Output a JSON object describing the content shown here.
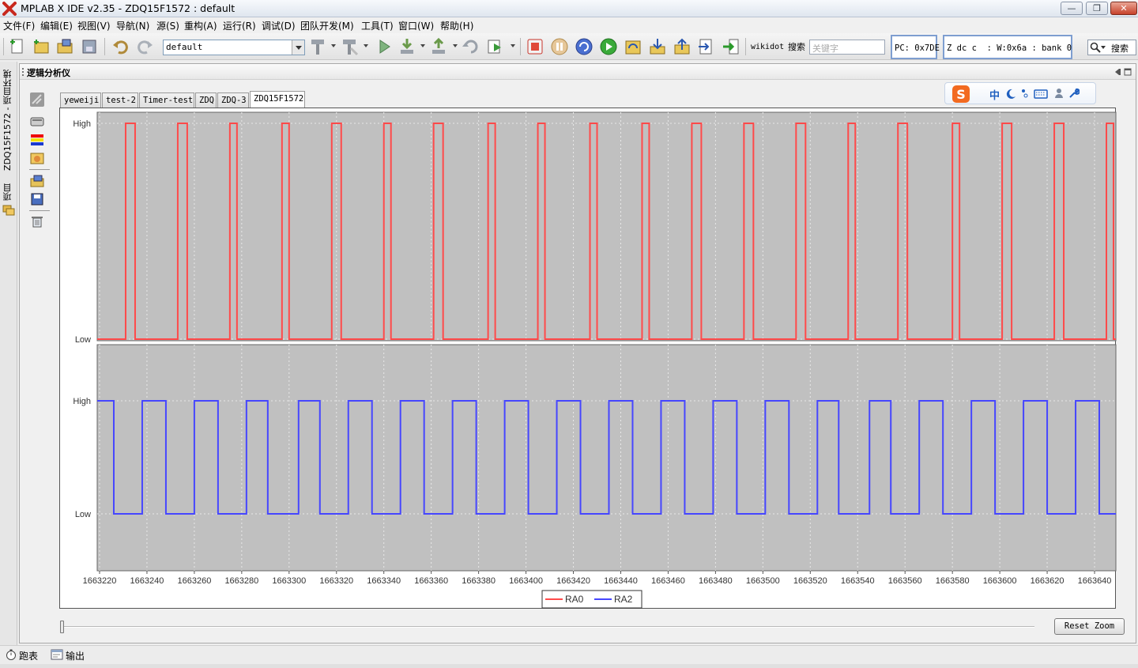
{
  "window": {
    "title": "MPLAB X IDE v2.35 - ZDQ15F1572 : default",
    "controls": {
      "minimize": "—",
      "maximize": "❐",
      "close": "✕"
    }
  },
  "menu": [
    "文件(F)",
    "编辑(E)",
    "视图(V)",
    "导航(N)",
    "源(S)",
    "重构(A)",
    "运行(R)",
    "调试(D)",
    "团队开发(M)",
    "工具(T)",
    "窗口(W)",
    "帮助(H)"
  ],
  "toolbar": {
    "config_value": "default",
    "wikidot_label": "wikidot",
    "search_label": "搜索",
    "search_placeholder": "关键字",
    "pc_status": "PC: 0x7DE",
    "reg_status": "Z dc c  : W:0x6a : bank 0",
    "global_search_label": "搜索"
  },
  "left_strip": {
    "tab1": "ZDQ15F1572 - 项目环境",
    "tab2": "项目"
  },
  "panel": {
    "title": "逻辑分析仪",
    "tabs": [
      "yeweiji",
      "test-2",
      "Timer-test",
      "ZDQ",
      "ZDQ-3",
      "ZDQ15F1572"
    ],
    "active_tab": "ZDQ15F1572",
    "reset_zoom_label": "Reset Zoom",
    "ime": {
      "lang": "中"
    }
  },
  "bottom_bar": {
    "item1": "跑表",
    "item2": "输出"
  },
  "colors": {
    "ra0": "#ff4a4a",
    "ra2": "#4646ff",
    "plot_bg": "#c0c0c0"
  },
  "chart_data": {
    "type": "line",
    "xlim": [
      1663219,
      1663649
    ],
    "x_ticks": [
      1663220,
      1663240,
      1663260,
      1663280,
      1663300,
      1663320,
      1663340,
      1663360,
      1663380,
      1663400,
      1663420,
      1663440,
      1663460,
      1663480,
      1663500,
      1663520,
      1663540,
      1663560,
      1663580,
      1663600,
      1663620,
      1663640
    ],
    "y_tick_labels": [
      "High",
      "Low"
    ],
    "grid": true,
    "legend_position": "bottom-center",
    "series": [
      {
        "name": "RA0",
        "pulses": [
          [
            1663231,
            1663235
          ],
          [
            1663253,
            1663257
          ],
          [
            1663275,
            1663278
          ],
          [
            1663297,
            1663300
          ],
          [
            1663318,
            1663322
          ],
          [
            1663340,
            1663343
          ],
          [
            1663361,
            1663365
          ],
          [
            1663384,
            1663387
          ],
          [
            1663405,
            1663408
          ],
          [
            1663427,
            1663430
          ],
          [
            1663449,
            1663452
          ],
          [
            1663470,
            1663474
          ],
          [
            1663492,
            1663496
          ],
          [
            1663514,
            1663518
          ],
          [
            1663536,
            1663539
          ],
          [
            1663557,
            1663561
          ],
          [
            1663580,
            1663583
          ],
          [
            1663601,
            1663605
          ],
          [
            1663623,
            1663627
          ],
          [
            1663645,
            1663648
          ]
        ]
      },
      {
        "name": "RA2",
        "pulses": [
          [
            1663219,
            1663226
          ],
          [
            1663238,
            1663248
          ],
          [
            1663260,
            1663270
          ],
          [
            1663282,
            1663291
          ],
          [
            1663304,
            1663313
          ],
          [
            1663325,
            1663335
          ],
          [
            1663347,
            1663357
          ],
          [
            1663369,
            1663379
          ],
          [
            1663391,
            1663401
          ],
          [
            1663413,
            1663423
          ],
          [
            1663435,
            1663445
          ],
          [
            1663457,
            1663467
          ],
          [
            1663479,
            1663489
          ],
          [
            1663501,
            1663511
          ],
          [
            1663523,
            1663532
          ],
          [
            1663545,
            1663554
          ],
          [
            1663566,
            1663576
          ],
          [
            1663588,
            1663598
          ],
          [
            1663610,
            1663620
          ],
          [
            1663632,
            1663642
          ]
        ]
      }
    ]
  }
}
